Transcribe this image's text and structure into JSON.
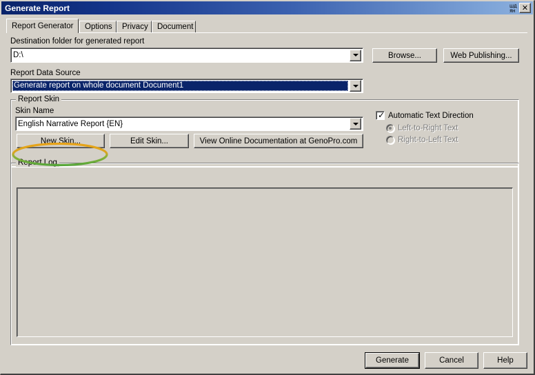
{
  "window": {
    "title": "Generate Report",
    "minimize_glyph": "minimize-icon",
    "maximize_glyph": "maximize-icon",
    "close_label": "✕",
    "titlebar_gradient_start": "#0a246a",
    "titlebar_gradient_end": "#8eb0dc",
    "face_color": "#d4d0c8"
  },
  "tabs": [
    {
      "label": "Report Generator",
      "active": true
    },
    {
      "label": "Options",
      "active": false
    },
    {
      "label": "Privacy",
      "active": false
    },
    {
      "label": "Document",
      "active": false
    }
  ],
  "destination": {
    "label": "Destination folder for generated report",
    "value": "D:\\",
    "placeholder": ""
  },
  "data_source": {
    "label": "Report Data Source",
    "value": "Generate report on whole document Document1",
    "selected": true,
    "selection_color": "#0a246a"
  },
  "toolbar": {
    "browse_label": "Browse...",
    "web_publishing_label": "Web Publishing..."
  },
  "report_skin": {
    "group_title": "Report Skin",
    "skin_name_label": "Skin Name",
    "skin_value": "English Narrative Report  {EN}",
    "new_skin_label": "New Skin...",
    "edit_skin_label": "Edit Skin...",
    "view_docs_label": "View Online Documentation at GenoPro.com",
    "highlight": {
      "target": "new-skin-button",
      "color_top": "#e8a317",
      "color_bottom": "#57a639"
    }
  },
  "text_direction": {
    "auto_label": "Automatic Text Direction",
    "auto_checked": true,
    "options": [
      {
        "label": "Left-to-Right Text",
        "selected": true,
        "disabled": true
      },
      {
        "label": "Right-to-Left Text",
        "selected": false,
        "disabled": true
      }
    ]
  },
  "report_log": {
    "group_title": "Report Log",
    "content": ""
  },
  "footer": {
    "generate_label": "Generate",
    "cancel_label": "Cancel",
    "help_label": "Help",
    "default_button": "generate-button"
  }
}
